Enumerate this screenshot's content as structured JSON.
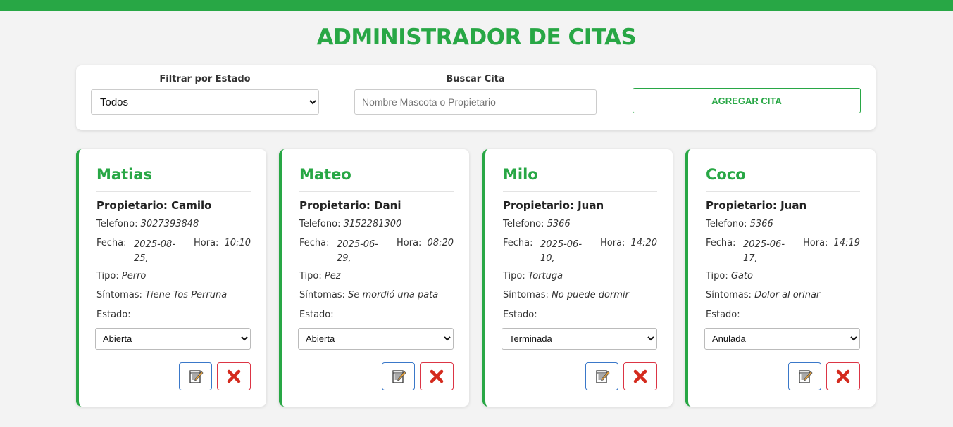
{
  "header": {
    "title": "ADMINISTRADOR DE CITAS"
  },
  "filters": {
    "state_label": "Filtrar por Estado",
    "state_selected": "Todos",
    "search_label": "Buscar Cita",
    "search_placeholder": "Nombre Mascota o Propietario",
    "add_button": "AGREGAR CITA"
  },
  "labels": {
    "telefono": "Telefono:",
    "fecha": "Fecha:",
    "hora": "Hora:",
    "tipo": "Tipo:",
    "sintomas": "Síntomas:",
    "estado": "Estado:"
  },
  "cards": [
    {
      "pet": "Matias",
      "owner": "Propietario: Camilo",
      "phone": "3027393848",
      "date": "2025-08-25,",
      "time": "10:10",
      "type": "Perro",
      "symptoms": "Tiene Tos Perruna",
      "status": "Abierta"
    },
    {
      "pet": "Mateo",
      "owner": "Propietario: Dani",
      "phone": "3152281300",
      "date": "2025-06-29,",
      "time": "08:20",
      "type": "Pez",
      "symptoms": "Se mordió una pata",
      "status": "Abierta"
    },
    {
      "pet": "Milo",
      "owner": "Propietario: Juan",
      "phone": "5366",
      "date": "2025-06-10,",
      "time": "14:20",
      "type": "Tortuga",
      "symptoms": "No puede dormir",
      "status": "Terminada"
    },
    {
      "pet": "Coco",
      "owner": "Propietario: Juan",
      "phone": "5366",
      "date": "2025-06-17,",
      "time": "14:19",
      "type": "Gato",
      "symptoms": "Dolor al orinar",
      "status": "Anulada"
    }
  ],
  "colors": {
    "accent": "#28a745",
    "edit": "#3a78c9",
    "delete": "#dc3545"
  },
  "icons": {
    "edit": "memo-icon",
    "delete": "cross-mark-icon"
  }
}
